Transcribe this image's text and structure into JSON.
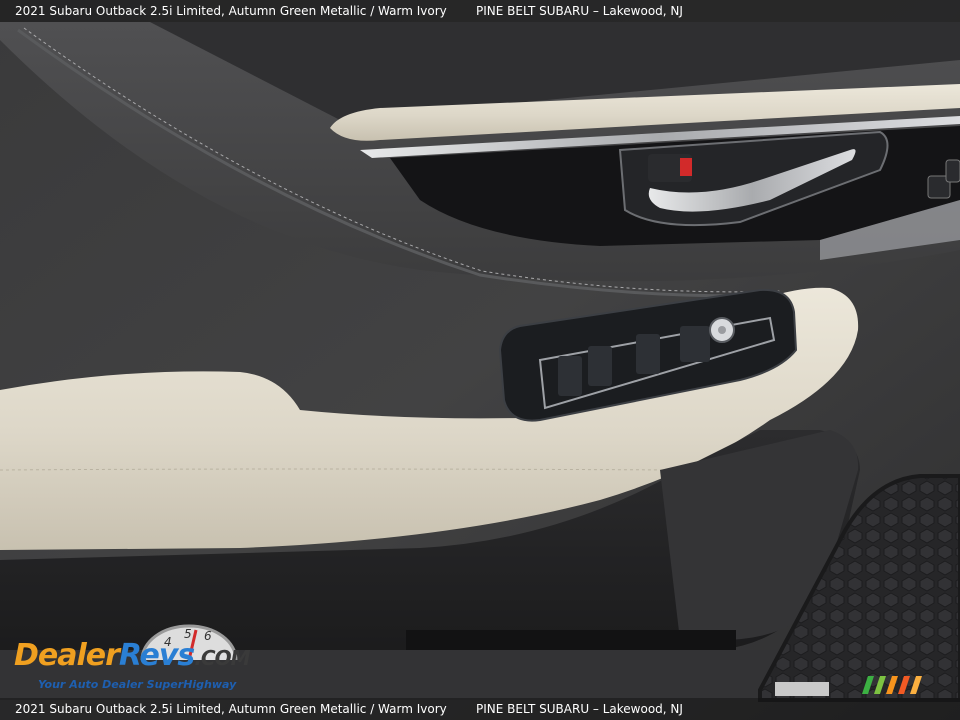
{
  "caption": {
    "vehicle": "2021 Subaru Outback 2.5i Limited,   Autumn Green Metallic / Warm Ivory",
    "dealer": "PINE BELT SUBARU – Lakewood, NJ"
  },
  "logo": {
    "dealer_text": "Dealer",
    "revs_text": "Revs",
    "com_text": ".COM",
    "tagline": "Your Auto Dealer SuperHighway",
    "gauge_numbers": [
      "4",
      "5",
      "6"
    ]
  },
  "photo": {
    "subject": "door-panel-interior",
    "colors": {
      "door_panel": "#3b3b3c",
      "armrest_ivory": "#d9d3c5",
      "chrome": "#c9cbcd",
      "switch_panel": "#1e2023",
      "speaker_grille": "#2b2b2d"
    }
  }
}
